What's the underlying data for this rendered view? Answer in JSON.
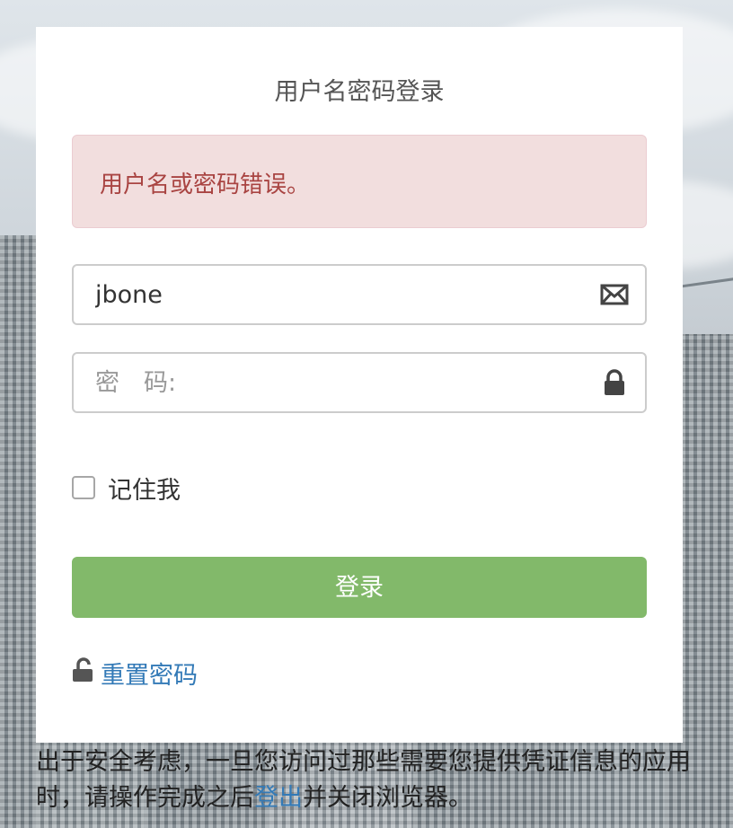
{
  "login": {
    "title": "用户名密码登录",
    "error_message": "用户名或密码错误。",
    "username": {
      "value": "jbone",
      "icon": "envelope-icon"
    },
    "password": {
      "placeholder": "密　码:",
      "value": "",
      "icon": "lock-icon"
    },
    "remember_label": "记住我",
    "remember_checked": false,
    "submit_label": "登录",
    "reset_link": {
      "label": "重置密码",
      "icon": "unlock-icon"
    }
  },
  "footer": {
    "text_before": "出于安全考虑，一旦您访问过那些需要您提供凭证信息的应用时，请操作完成之后",
    "logout_link": "登出",
    "text_after": "并关闭浏览器。"
  },
  "colors": {
    "alert_bg": "#f2dede",
    "alert_text": "#a94442",
    "button_bg": "#82b96a",
    "link": "#337ab7"
  }
}
